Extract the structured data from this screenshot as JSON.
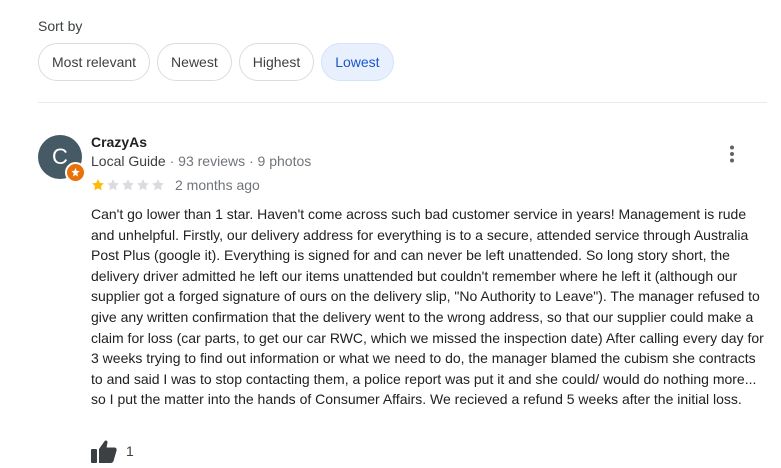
{
  "sort": {
    "label": "Sort by",
    "options": [
      {
        "label": "Most relevant",
        "selected": false
      },
      {
        "label": "Newest",
        "selected": false
      },
      {
        "label": "Highest",
        "selected": false
      },
      {
        "label": "Lowest",
        "selected": true
      }
    ]
  },
  "review": {
    "avatar_initial": "C",
    "avatar_color": "#455a64",
    "badge_color": "#e8710a",
    "author": "CrazyAs",
    "author_role": "Local Guide",
    "reviews_count": "93 reviews",
    "photos_count": "9 photos",
    "rating": 1,
    "max_rating": 5,
    "star_color": "#fbbc04",
    "date": "2 months ago",
    "text": "Can't go lower than 1 star. Haven't come across such bad customer service in years! Management is rude and unhelpful. Firstly, our delivery address for everything is to a secure, attended service through Australia Post Plus (google it). Everything is signed for and can never be left unattended. So long story short, the delivery driver admitted he left our items unattended but couldn't remember where he left it (although our supplier got a forged signature of ours on the delivery slip, \"No Authority to Leave\"). The manager refused to give any written confirmation that the delivery went to the wrong address, so that our supplier could make a claim for loss (car parts, to get our car RWC, which we missed the inspection date) After calling every day for 3 weeks trying to find out information or what we need to do,  the manager blamed the cubism she contracts to and said I was to stop contacting them, a police report was put it and she could/ would do nothing more... so I put the matter into the hands of Consumer Affairs. We recieved a refund 5 weeks after the initial loss.",
    "likes": "1",
    "more_icon": "more-vert-icon",
    "like_icon": "thumbs-up-icon"
  }
}
